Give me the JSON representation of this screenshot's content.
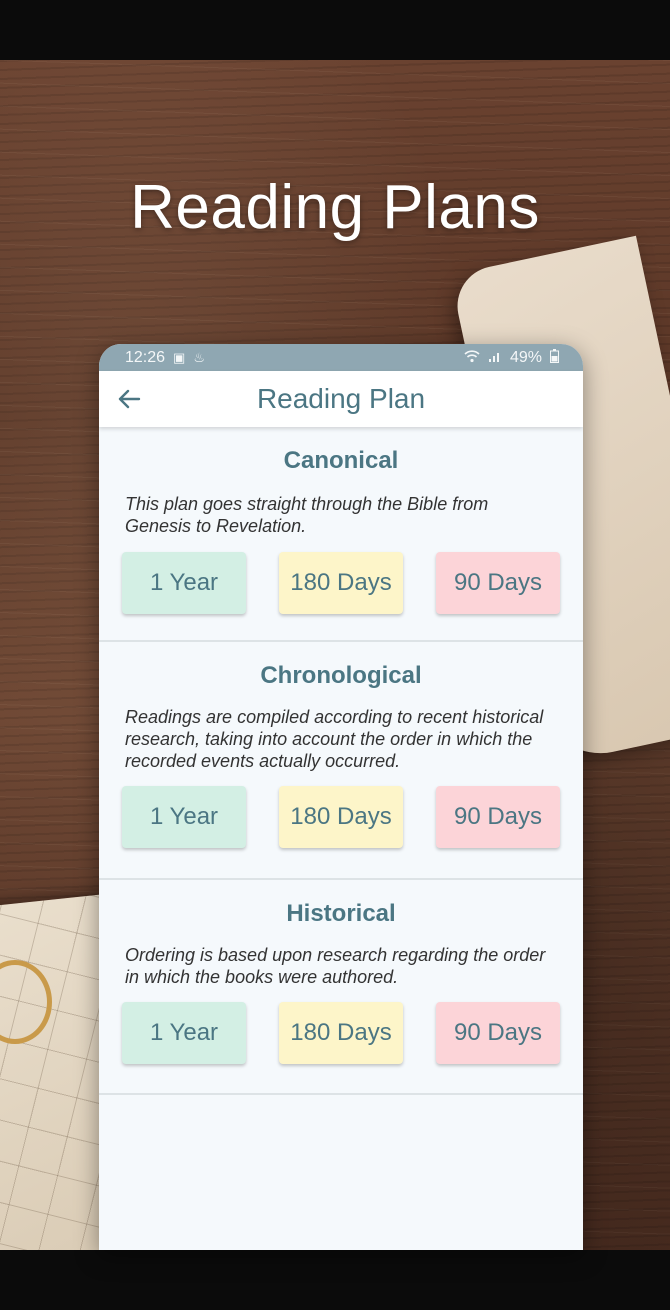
{
  "promo": {
    "headline": "Reading Plans"
  },
  "status_bar": {
    "time": "12:26",
    "battery": "49%"
  },
  "app_bar": {
    "title": "Reading Plan"
  },
  "colors": {
    "accent": "#4b7683",
    "status_bar": "#8fa7b2",
    "btn_green": "#d3efe4",
    "btn_yellow": "#fdf5c9",
    "btn_red": "#fcd4d8"
  },
  "plans": [
    {
      "title": "Canonical",
      "description": "This plan goes straight through the Bible from Genesis to Revelation.",
      "options": [
        "1 Year",
        "180 Days",
        "90 Days"
      ]
    },
    {
      "title": "Chronological",
      "description": "Readings are compiled according to recent historical research, taking into account the order in which the recorded events actually occurred.",
      "options": [
        "1 Year",
        "180 Days",
        "90 Days"
      ]
    },
    {
      "title": "Historical",
      "description": "Ordering is based upon research regarding the order in which the books were authored.",
      "options": [
        "1 Year",
        "180 Days",
        "90 Days"
      ]
    }
  ]
}
